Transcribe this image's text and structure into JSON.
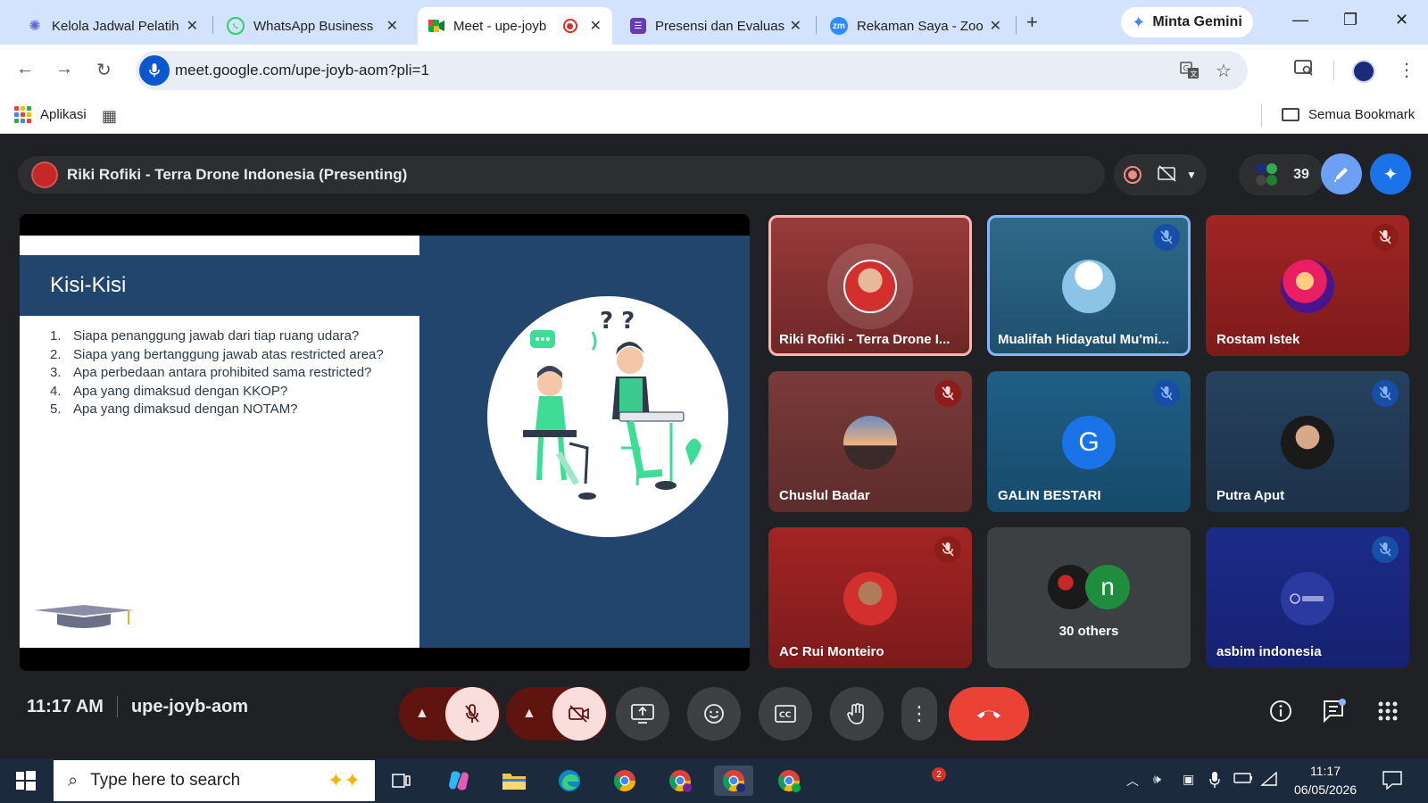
{
  "browser": {
    "tabs": [
      {
        "label": "Kelola Jadwal Pelatih",
        "icon": "schedule-icon",
        "active": false
      },
      {
        "label": "WhatsApp Business",
        "icon": "whatsapp-icon",
        "active": false
      },
      {
        "label": "Meet - upe-joyb",
        "icon": "meet-icon",
        "active": true
      },
      {
        "label": "Presensi dan Evaluas",
        "icon": "forms-icon",
        "active": false
      },
      {
        "label": "Rekaman Saya - Zoo",
        "icon": "zoom-icon",
        "active": false
      }
    ],
    "gemini_label": "Minta Gemini",
    "url": "meet.google.com/upe-joyb-aom?pli=1",
    "bookmarks": {
      "apps_label": "Aplikasi",
      "all_bookmarks_label": "Semua Bookmark"
    }
  },
  "meet": {
    "presenting_label": "Riki Rofiki - Terra Drone Indonesia (Presenting)",
    "participant_count": "39",
    "time": "11:17 AM",
    "meeting_code": "upe-joyb-aom",
    "slide": {
      "title": "Kisi-Kisi",
      "items": [
        {
          "num": "1.",
          "text": "Siapa penanggung jawab dari tiap ruang udara?"
        },
        {
          "num": "2.",
          "text": "Siapa yang bertanggung jawab atas restricted area?"
        },
        {
          "num": "3.",
          "text": "Apa perbedaan antara prohibited sama restricted?"
        },
        {
          "num": "4.",
          "text": "Apa yang dimaksud dengan KKOP?"
        },
        {
          "num": "5.",
          "text": "Apa yang dimaksud dengan NOTAM?"
        }
      ]
    },
    "tiles": [
      {
        "name": "Riki Rofiki - Terra Drone I...",
        "muted": false
      },
      {
        "name": "Mualifah Hidayatul Mu'mi...",
        "muted": true
      },
      {
        "name": "Rostam Istek",
        "muted": true
      },
      {
        "name": "Chuslul Badar",
        "muted": true
      },
      {
        "name": "GALIN BESTARI",
        "initial": "G",
        "muted": true
      },
      {
        "name": "Putra Aput",
        "muted": true
      },
      {
        "name": "AC Rui Monteiro",
        "muted": true
      },
      {
        "name": "30 others",
        "initial": "n"
      },
      {
        "name": "asbim indonesia",
        "muted": true
      }
    ],
    "colors": {
      "hangup": "#ea4335",
      "muted_btn_bg": "#f9dedc",
      "muted_btn_dark": "#601410",
      "accent_blue": "#8ab4f8"
    }
  },
  "taskbar": {
    "search_placeholder": "Type here to search",
    "time": "11:17",
    "date": "06/05/2026",
    "notification_badge": "2"
  }
}
